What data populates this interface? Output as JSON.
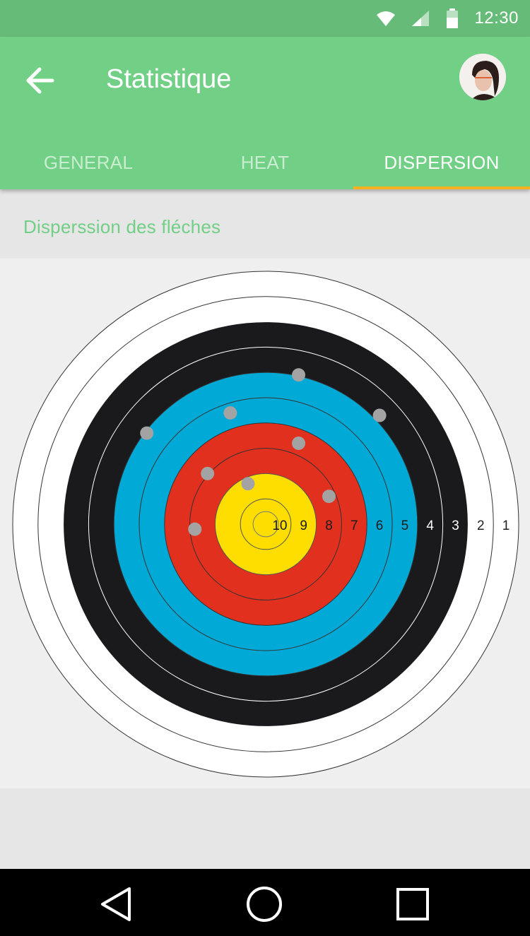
{
  "status_bar": {
    "time": "12:30",
    "icons": [
      "wifi-icon",
      "signal-icon",
      "battery-icon"
    ]
  },
  "app_bar": {
    "back_icon": "arrow-left-icon",
    "title": "Statistique",
    "avatar": "user-avatar"
  },
  "tabs": [
    {
      "label": "GENERAL",
      "active": false
    },
    {
      "label": "HEAT",
      "active": false
    },
    {
      "label": "DISPERSION",
      "active": true
    }
  ],
  "section": {
    "title": "Disperssion des fléches"
  },
  "colors": {
    "status_bar": "#66bb79",
    "app_bar": "#72cf86",
    "tab_indicator": "#f6b21e",
    "ring_white": "#ffffff",
    "ring_black": "#1a1a1c",
    "ring_blue": "#00a9d6",
    "ring_red": "#e2301f",
    "ring_yellow": "#fedd00",
    "arrow_mark": "#a3a3a3"
  },
  "chart_data": {
    "type": "scatter",
    "title": "Disperssion des fléches",
    "rings": [
      {
        "score": 1,
        "color": "white"
      },
      {
        "score": 2,
        "color": "white"
      },
      {
        "score": 3,
        "color": "black"
      },
      {
        "score": 4,
        "color": "black"
      },
      {
        "score": 5,
        "color": "blue"
      },
      {
        "score": 6,
        "color": "blue"
      },
      {
        "score": 7,
        "color": "red"
      },
      {
        "score": 8,
        "color": "red"
      },
      {
        "score": 9,
        "color": "yellow"
      },
      {
        "score": 10,
        "color": "yellow"
      }
    ],
    "ring_labels": [
      "10",
      "9",
      "8",
      "7",
      "6",
      "5",
      "4",
      "3",
      "2",
      "1"
    ],
    "axis_range": {
      "x": [
        -10,
        10
      ],
      "y": [
        -10,
        10
      ]
    },
    "arrows": [
      {
        "x": 1.3,
        "y": 5.9
      },
      {
        "x": 4.5,
        "y": 4.3
      },
      {
        "x": -1.4,
        "y": 4.4
      },
      {
        "x": -4.7,
        "y": 3.6
      },
      {
        "x": 1.3,
        "y": 3.2
      },
      {
        "x": -2.3,
        "y": 2.0
      },
      {
        "x": -0.7,
        "y": 1.6
      },
      {
        "x": 2.5,
        "y": 1.1
      },
      {
        "x": -2.8,
        "y": -0.2
      }
    ]
  },
  "nav_bar": {
    "buttons": [
      "back-nav-icon",
      "home-nav-icon",
      "recents-nav-icon"
    ]
  }
}
